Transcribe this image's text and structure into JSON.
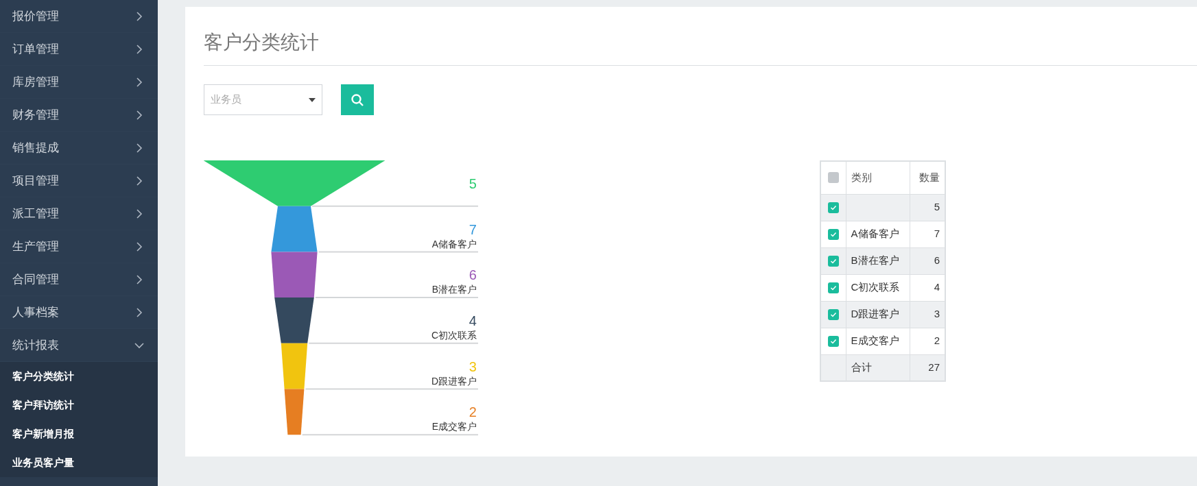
{
  "sidebar": {
    "items": [
      {
        "label": "报价管理",
        "expanded": false
      },
      {
        "label": "订单管理",
        "expanded": false
      },
      {
        "label": "库房管理",
        "expanded": false
      },
      {
        "label": "财务管理",
        "expanded": false
      },
      {
        "label": "销售提成",
        "expanded": false
      },
      {
        "label": "项目管理",
        "expanded": false
      },
      {
        "label": "派工管理",
        "expanded": false
      },
      {
        "label": "生产管理",
        "expanded": false
      },
      {
        "label": "合同管理",
        "expanded": false
      },
      {
        "label": "人事档案",
        "expanded": false
      },
      {
        "label": "统计报表",
        "expanded": true,
        "children": [
          {
            "label": "客户分类统计"
          },
          {
            "label": "客户拜访统计"
          },
          {
            "label": "客户新增月报"
          },
          {
            "label": "业务员客户量"
          }
        ]
      }
    ]
  },
  "page": {
    "title": "客户分类统计"
  },
  "filter": {
    "salesperson": {
      "placeholder": "业务员"
    }
  },
  "funnel": {
    "stages": [
      {
        "value": "5",
        "color": "#2ecc71"
      },
      {
        "value": "7",
        "label": "A储备客户",
        "color": "#3498db"
      },
      {
        "value": "6",
        "label": "B潜在客户",
        "color": "#9b59b6"
      },
      {
        "value": "4",
        "label": "C初次联系",
        "color": "#34495e"
      },
      {
        "value": "3",
        "label": "D跟进客户",
        "color": "#f1c40f"
      },
      {
        "value": "2",
        "label": "E成交客户",
        "color": "#e67e22"
      }
    ]
  },
  "table": {
    "select_all": {
      "checked": false
    },
    "columns": [
      "类别",
      "数量"
    ],
    "rows": [
      {
        "checked": true,
        "count": "5"
      },
      {
        "checked": true,
        "category": "A储备客户",
        "count": "7"
      },
      {
        "checked": true,
        "category": "B潜在客户",
        "count": "6"
      },
      {
        "checked": true,
        "category": "C初次联系",
        "count": "4"
      },
      {
        "checked": true,
        "category": "D跟进客户",
        "count": "3"
      },
      {
        "checked": true,
        "category": "E成交客户",
        "count": "2"
      }
    ],
    "total": {
      "label": "合计",
      "count": "27"
    }
  }
}
